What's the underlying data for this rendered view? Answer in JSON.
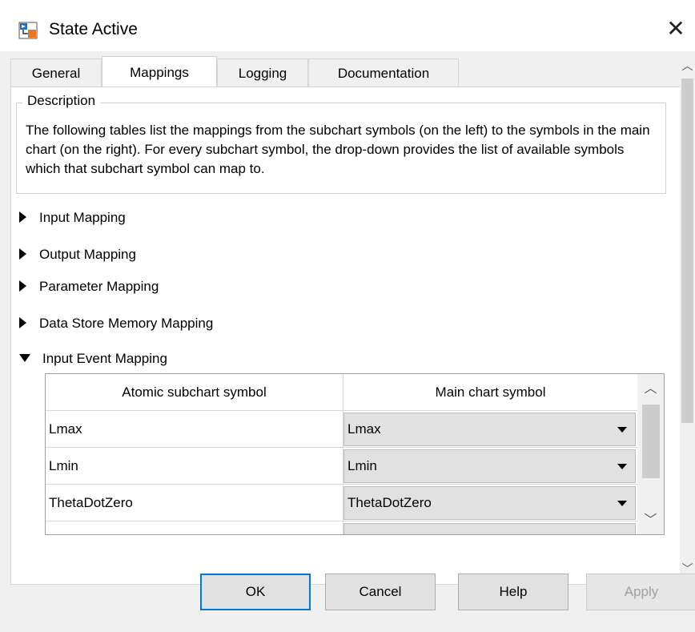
{
  "window": {
    "title": "State Active",
    "close_icon": "close-icon"
  },
  "tabs": [
    {
      "label": "General",
      "active": false
    },
    {
      "label": "Mappings",
      "active": true
    },
    {
      "label": "Logging",
      "active": false
    },
    {
      "label": "Documentation",
      "active": false
    }
  ],
  "description": {
    "legend": "Description",
    "text": "The following tables list the mappings from the subchart symbols (on the left) to the symbols in the main chart (on the right). For every subchart symbol, the drop-down provides the list of available symbols which that subchart symbol can map to."
  },
  "sections": [
    {
      "label": "Input Mapping",
      "expanded": false
    },
    {
      "label": "Output Mapping",
      "expanded": false
    },
    {
      "label": "Parameter Mapping",
      "expanded": false
    },
    {
      "label": "Data Store Memory Mapping",
      "expanded": false
    },
    {
      "label": "Input Event Mapping",
      "expanded": true
    }
  ],
  "table": {
    "headers": [
      "Atomic subchart symbol",
      "Main chart symbol"
    ],
    "rows": [
      {
        "symbol": "Lmax",
        "mapped": "Lmax"
      },
      {
        "symbol": "Lmin",
        "mapped": "Lmin"
      },
      {
        "symbol": "ThetaDotZero",
        "mapped": "ThetaDotZero"
      }
    ]
  },
  "buttons": {
    "ok": "OK",
    "cancel": "Cancel",
    "help": "Help",
    "apply": "Apply"
  },
  "colors": {
    "accent": "#0078d7",
    "background": "#f0f0f0"
  }
}
